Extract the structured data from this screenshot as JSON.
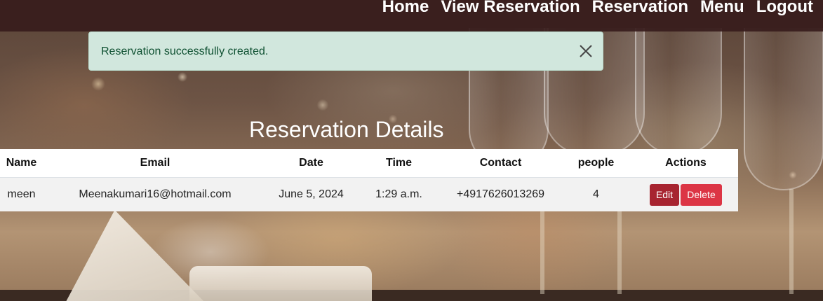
{
  "nav": {
    "items": [
      {
        "label": "Home"
      },
      {
        "label": "View Reservation"
      },
      {
        "label": "Reservation"
      },
      {
        "label": "Menu"
      },
      {
        "label": "Logout"
      }
    ]
  },
  "alert": {
    "message": "Reservation successfully created.",
    "close_icon": "close-icon"
  },
  "page": {
    "heading": "Reservation Details"
  },
  "table": {
    "headers": [
      "Name",
      "Email",
      "Date",
      "Time",
      "Contact",
      "people",
      "Actions"
    ],
    "rows": [
      {
        "name": "meen",
        "email": "Meenakumari16@hotmail.com",
        "date": "June 5, 2024",
        "time": "1:29 a.m.",
        "contact": "+4917626013269",
        "people": "4",
        "edit_label": "Edit",
        "delete_label": "Delete"
      }
    ]
  },
  "colors": {
    "navbar": "#371c1c",
    "alert_bg": "#d1e7dd",
    "alert_text": "#0f5132",
    "edit_button": "#a72430",
    "delete_button": "#dc3545"
  }
}
